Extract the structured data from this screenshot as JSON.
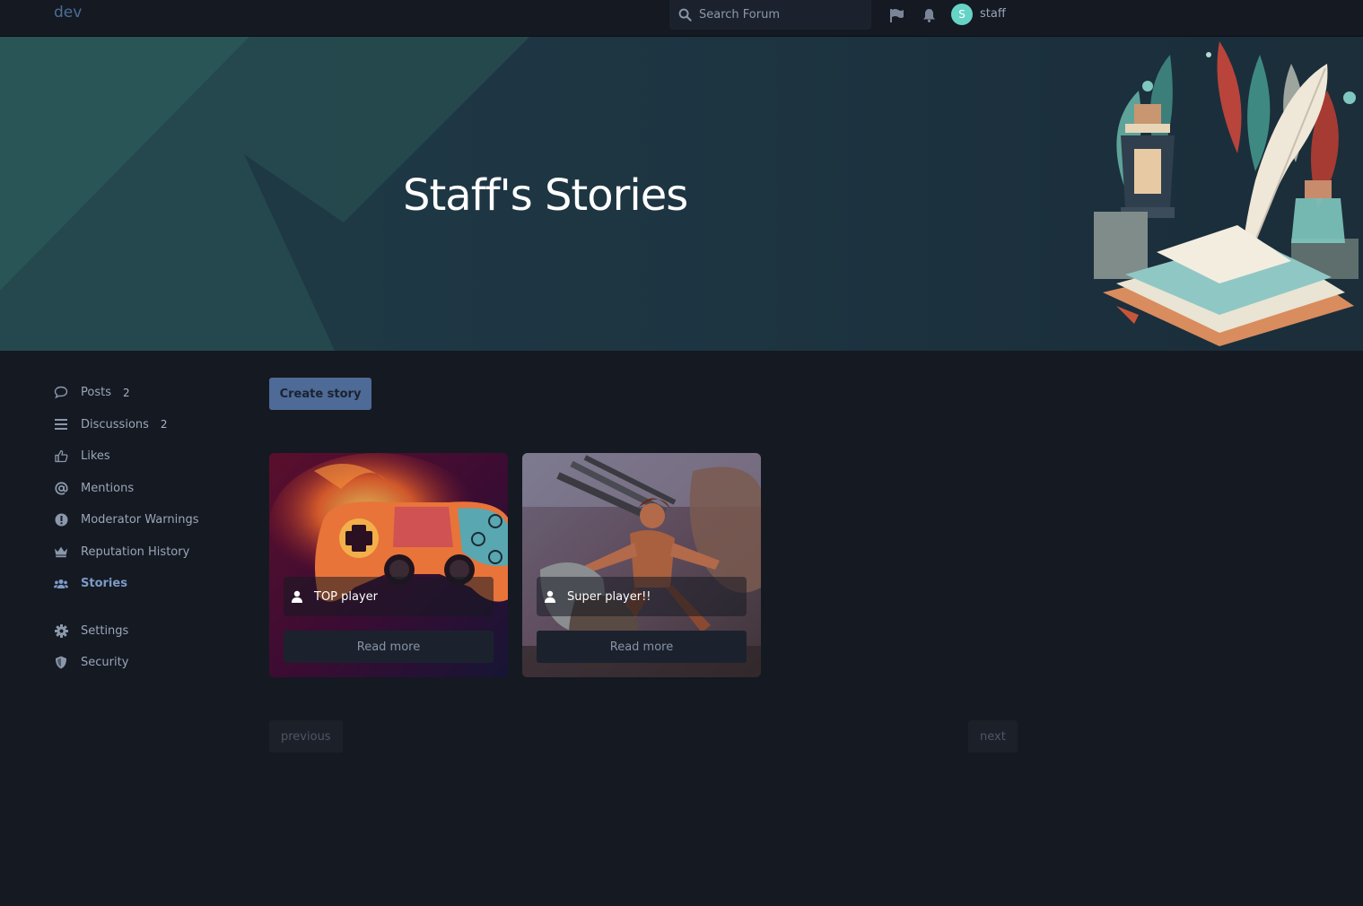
{
  "header": {
    "brand": "dev",
    "search_placeholder": "Search Forum",
    "avatar_letter": "S",
    "username": "staff"
  },
  "hero": {
    "title": "Staff's Stories"
  },
  "sidebar": {
    "items": [
      {
        "label": "Posts",
        "count": "2",
        "icon": "speech-bubble-icon"
      },
      {
        "label": "Discussions",
        "count": "2",
        "icon": "list-icon"
      },
      {
        "label": "Likes",
        "count": "",
        "icon": "thumbs-up-icon"
      },
      {
        "label": "Mentions",
        "count": "",
        "icon": "at-icon"
      },
      {
        "label": "Moderator Warnings",
        "count": "",
        "icon": "exclamation-icon"
      },
      {
        "label": "Reputation History",
        "count": "",
        "icon": "crown-icon"
      },
      {
        "label": "Stories",
        "count": "",
        "icon": "users-icon"
      }
    ],
    "settings_items": [
      {
        "label": "Settings",
        "icon": "gear-icon"
      },
      {
        "label": "Security",
        "icon": "shield-icon"
      }
    ]
  },
  "main": {
    "create_label": "Create story",
    "stories": [
      {
        "author": "TOP player",
        "read_label": "Read more"
      },
      {
        "author": "Super player!!",
        "read_label": "Read more"
      }
    ],
    "pagination": {
      "previous": "previous",
      "next": "next"
    }
  },
  "colors": {
    "background": "#151922",
    "accent": "#4e6a96",
    "avatar": "#67d3c6"
  }
}
